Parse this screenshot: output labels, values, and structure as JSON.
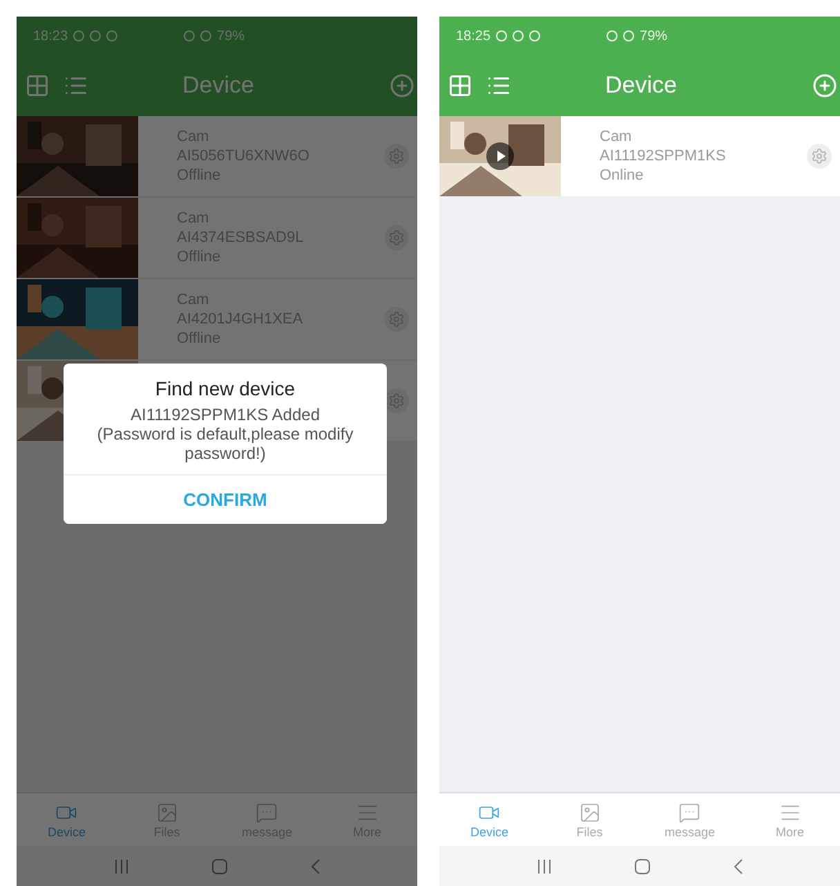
{
  "screens": [
    {
      "status": {
        "time": "18:23",
        "battery": "79%"
      },
      "title": "Device",
      "devices": [
        {
          "kind": "full",
          "name": "Cam",
          "id": "AI5056TU6XNW6O",
          "status": "Offline",
          "playable": false
        },
        {
          "kind": "full",
          "name": "Cam",
          "id": "AI4374ESBSAD9L",
          "status": "Offline",
          "playable": false
        },
        {
          "kind": "full",
          "name": "Cam",
          "id": "AI4201J4GH1XEA",
          "status": "Offline",
          "playable": false
        },
        {
          "kind": "covered"
        }
      ],
      "dialog": {
        "title": "Find new device",
        "message": "AI11192SPPM1KS Added\n(Password is default,please modify password!)",
        "button": "CONFIRM"
      },
      "tabs": [
        {
          "label": "Device",
          "selected": true
        },
        {
          "label": "Files",
          "selected": false
        },
        {
          "label": "message",
          "selected": false
        },
        {
          "label": "More",
          "selected": false
        }
      ]
    },
    {
      "status": {
        "time": "18:25",
        "battery": "79%"
      },
      "title": "Device",
      "devices": [
        {
          "kind": "full",
          "name": "Cam",
          "id": "AI11192SPPM1KS",
          "status": "Online",
          "playable": true
        }
      ],
      "tabs": [
        {
          "label": "Device",
          "selected": true
        },
        {
          "label": "Files",
          "selected": false
        },
        {
          "label": "message",
          "selected": false
        },
        {
          "label": "More",
          "selected": false
        }
      ]
    }
  ]
}
